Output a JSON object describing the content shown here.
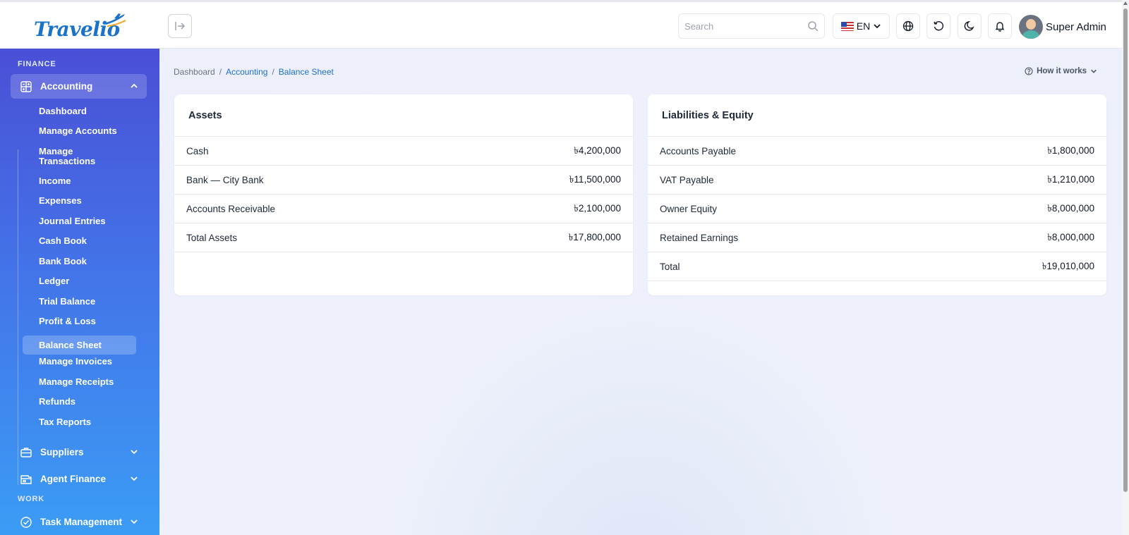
{
  "header": {
    "logo_text": "Travelio",
    "search_placeholder": "Search",
    "language": "EN",
    "user_name": "Super Admin"
  },
  "sidebar": {
    "section_finance": "FINANCE",
    "section_work": "WORK",
    "accounting": {
      "label": "Accounting",
      "items": [
        {
          "label": "Dashboard"
        },
        {
          "label": "Manage Accounts"
        },
        {
          "label": "Manage\nTransactions"
        },
        {
          "label": "Income"
        },
        {
          "label": "Expenses"
        },
        {
          "label": "Journal Entries"
        },
        {
          "label": "Cash Book"
        },
        {
          "label": "Bank Book"
        },
        {
          "label": "Ledger"
        },
        {
          "label": "Trial Balance"
        },
        {
          "label": "Profit & Loss"
        },
        {
          "label": "Balance Sheet"
        },
        {
          "label": "Manage Invoices"
        },
        {
          "label": "Manage Receipts"
        },
        {
          "label": "Refunds"
        },
        {
          "label": "Tax Reports"
        }
      ]
    },
    "suppliers": "Suppliers",
    "agent_finance": "Agent Finance",
    "task_management": "Task Management"
  },
  "breadcrumb": {
    "home": "Dashboard",
    "section": "Accounting",
    "current": "Balance Sheet",
    "separator": "/"
  },
  "help": {
    "label": "How it works"
  },
  "assets": {
    "title": "Assets",
    "rows": [
      {
        "label": "Cash",
        "amount": "৳4,200,000"
      },
      {
        "label": "Bank — City Bank",
        "amount": "৳11,500,000"
      },
      {
        "label": "Accounts Receivable",
        "amount": "৳2,100,000"
      },
      {
        "label": "Total Assets",
        "amount": "৳17,800,000"
      }
    ]
  },
  "liabilities": {
    "title": "Liabilities & Equity",
    "rows": [
      {
        "label": "Accounts Payable",
        "amount": "৳1,800,000"
      },
      {
        "label": "VAT Payable",
        "amount": "৳1,210,000"
      },
      {
        "label": "Owner Equity",
        "amount": "৳8,000,000"
      },
      {
        "label": "Retained Earnings",
        "amount": "৳8,000,000"
      },
      {
        "label": "Total",
        "amount": "৳19,010,000"
      }
    ]
  },
  "colors": {
    "brand": "#1a73c9",
    "sidebar_top": "#4a4fd6",
    "sidebar_bottom": "#3b9cf5",
    "link": "#1e6fd0"
  }
}
